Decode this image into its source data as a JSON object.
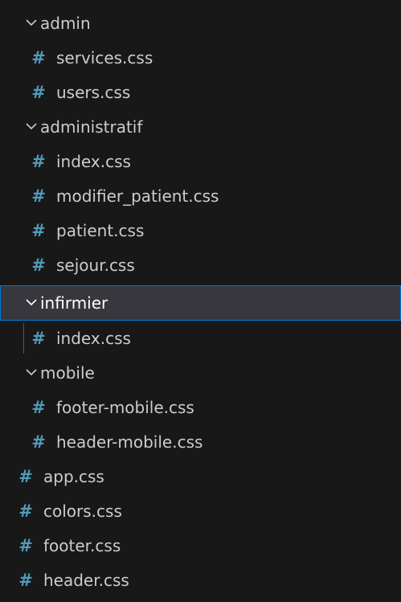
{
  "explorer": {
    "rows": [
      {
        "type": "folder",
        "label": "admin",
        "expanded": true
      },
      {
        "type": "file",
        "label": "services.css",
        "icon": "css-hash-icon"
      },
      {
        "type": "file",
        "label": "users.css",
        "icon": "css-hash-icon"
      },
      {
        "type": "folder",
        "label": "administratif",
        "expanded": true
      },
      {
        "type": "file",
        "label": "index.css",
        "icon": "css-hash-icon"
      },
      {
        "type": "file",
        "label": "modifier_patient.css",
        "icon": "css-hash-icon"
      },
      {
        "type": "file",
        "label": "patient.css",
        "icon": "css-hash-icon"
      },
      {
        "type": "file",
        "label": "sejour.css",
        "icon": "css-hash-icon"
      },
      {
        "type": "folder",
        "label": "infirmier",
        "expanded": true,
        "selected": true
      },
      {
        "type": "file",
        "label": "index.css",
        "icon": "css-hash-icon"
      },
      {
        "type": "folder",
        "label": "mobile",
        "expanded": true
      },
      {
        "type": "file",
        "label": "footer-mobile.css",
        "icon": "css-hash-icon"
      },
      {
        "type": "file",
        "label": "header-mobile.css",
        "icon": "css-hash-icon"
      },
      {
        "type": "file",
        "label": "app.css",
        "icon": "css-hash-icon"
      },
      {
        "type": "file",
        "label": "colors.css",
        "icon": "css-hash-icon"
      },
      {
        "type": "file",
        "label": "footer.css",
        "icon": "css-hash-icon"
      },
      {
        "type": "file",
        "label": "header.css",
        "icon": "css-hash-icon"
      }
    ],
    "file_icon_glyph": "#",
    "colors": {
      "background": "#181818",
      "text": "#cccccc",
      "css_icon": "#519aba",
      "selection_background": "#37373d",
      "selection_border": "#0078d4"
    }
  }
}
